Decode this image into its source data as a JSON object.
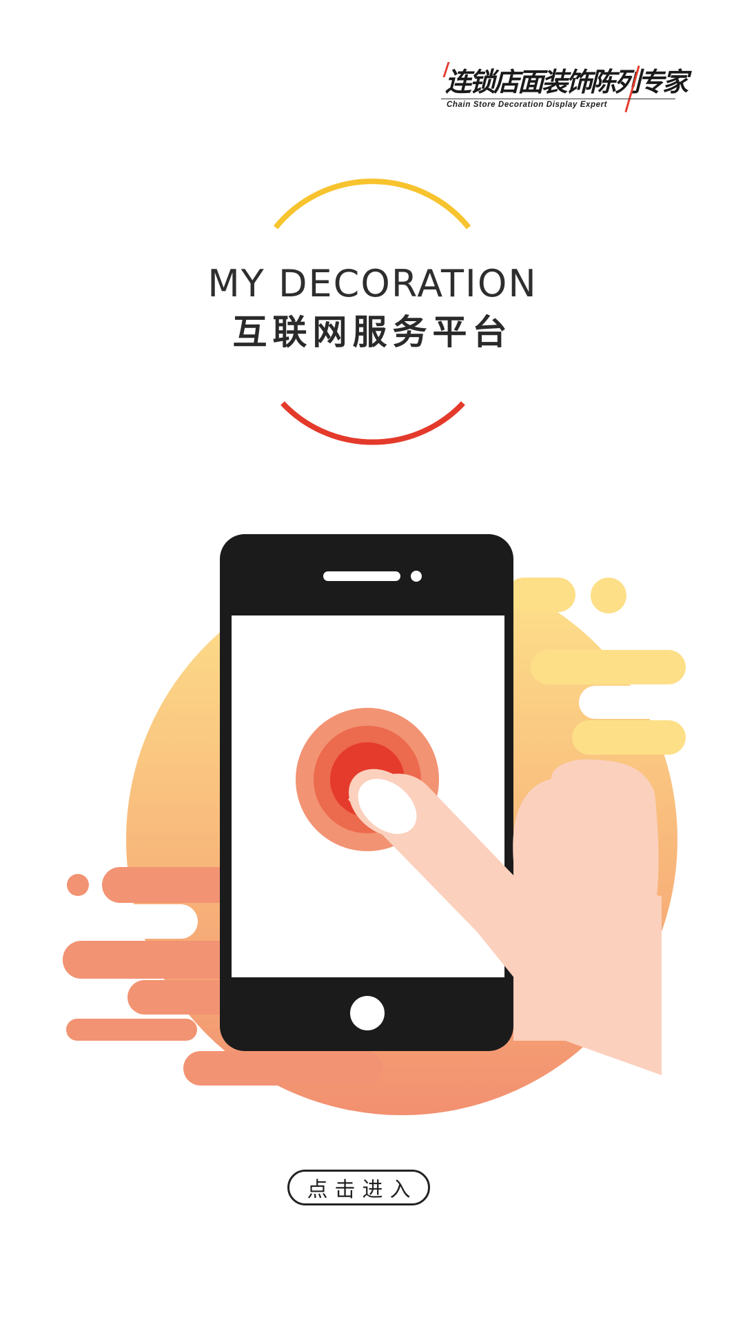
{
  "brand": {
    "name_cn": "连锁店面装饰陈列专家",
    "tagline_en": "Chain Store Decoration Display Expert"
  },
  "title": {
    "en": "MY DECORATION",
    "cn": "互联网服务平台"
  },
  "enter_button": {
    "label": "点击进入"
  },
  "colors": {
    "arc_top": "#f7c32e",
    "arc_bottom": "#e43a2b",
    "phone": "#1b1b1b",
    "circle_light": "#fddf88",
    "circle_dark": "#f28d6c",
    "finger": "#fbd0bd",
    "ripple_outer": "#f29373",
    "ripple_mid": "#ec6a4d",
    "ripple_inner": "#e53b2c"
  }
}
